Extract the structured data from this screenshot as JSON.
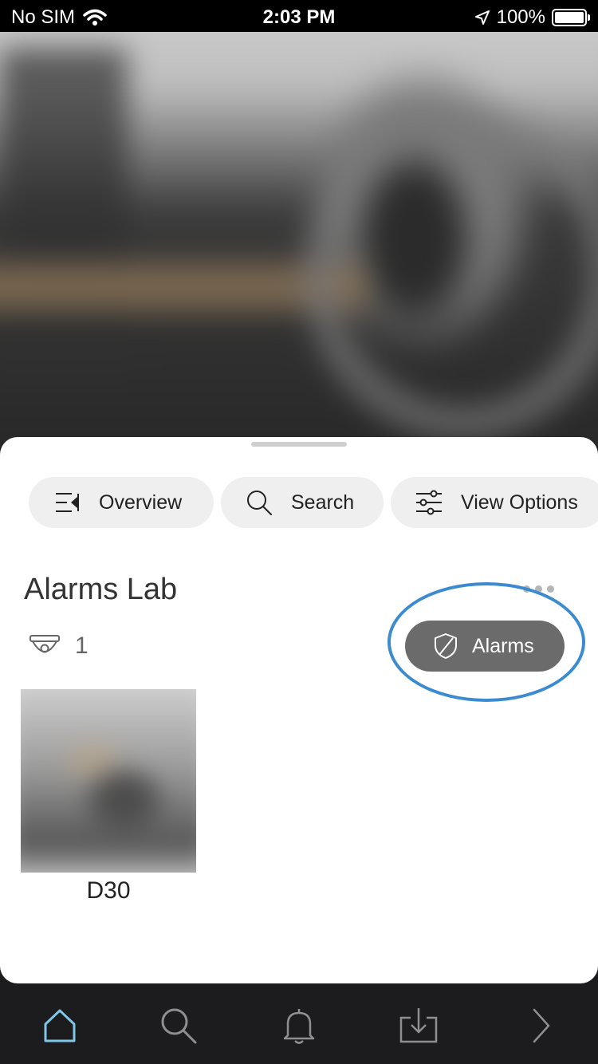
{
  "status_bar": {
    "carrier": "No SIM",
    "time": "2:03 PM",
    "battery_percent": "100%",
    "battery_level": 1.0,
    "icons": [
      "wifi-icon",
      "location-arrow-icon",
      "battery-icon"
    ]
  },
  "live_view": {
    "icon": "camera-live-feed"
  },
  "toolbar": {
    "chips": [
      {
        "label": "Overview",
        "icon": "overview-icon"
      },
      {
        "label": "Search",
        "icon": "search-icon"
      },
      {
        "label": "View Options",
        "icon": "sliders-icon"
      }
    ]
  },
  "site": {
    "title": "Alarms Lab",
    "camera_count": "1",
    "camera_icon": "dome-camera-icon"
  },
  "alarms_button": {
    "label": "Alarms",
    "icon": "shield-off-icon",
    "highlight_color": "#3b8bd0"
  },
  "cameras": [
    {
      "label": "D30"
    }
  ],
  "tab_bar": {
    "active_color": "#7fc7e6",
    "items": [
      {
        "icon": "home-icon",
        "active": true
      },
      {
        "icon": "search-icon",
        "active": false
      },
      {
        "icon": "bell-icon",
        "active": false
      },
      {
        "icon": "download-tray-icon",
        "active": false
      },
      {
        "icon": "chevron-right-icon",
        "active": false
      }
    ]
  }
}
